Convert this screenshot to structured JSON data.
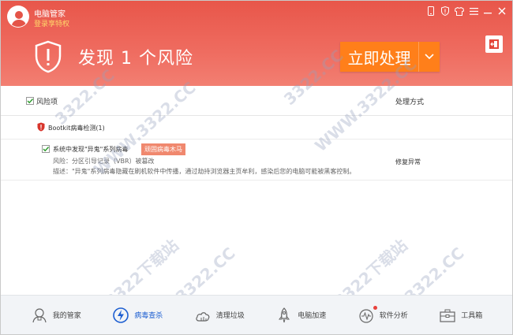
{
  "app": {
    "name": "电脑管家",
    "login_text": "登录享特权"
  },
  "header": {
    "risk_title": "发现 1 个风险",
    "fix_button": "立即处理"
  },
  "table": {
    "col_risk": "风险项",
    "col_method": "处理方式"
  },
  "group": {
    "title": "Bootkit病毒检测(1)"
  },
  "risk_row": {
    "title": "系统中发现\"异鬼\"系列病毒",
    "badge": "顽固病毒木马",
    "risk_line": "风险：分区引导记录（VBR）被篡改",
    "desc_line": "描述：\"异鬼\"系列病毒隐藏在刷机软件中传播，通过劫持浏览器主页牟利，感染后您的电脑可能被黑客控制。",
    "action": "修复异常"
  },
  "nav": {
    "items": [
      {
        "label": "我的管家",
        "icon": "butler-icon"
      },
      {
        "label": "病毒查杀",
        "icon": "virus-scan-icon"
      },
      {
        "label": "清理垃圾",
        "icon": "cleanup-icon"
      },
      {
        "label": "电脑加速",
        "icon": "rocket-icon"
      },
      {
        "label": "软件分析",
        "icon": "software-analysis-icon"
      },
      {
        "label": "工具箱",
        "icon": "toolbox-icon"
      }
    ],
    "active_index": 1
  },
  "watermark": {
    "a": "3322.CC",
    "b": "WWW.3322.CC",
    "c": "3322下载站"
  },
  "colors": {
    "header_red": "#ec5d51",
    "fix_orange": "#ff7f1a",
    "badge": "#f0886e",
    "active_nav": "#1e5fd1"
  }
}
